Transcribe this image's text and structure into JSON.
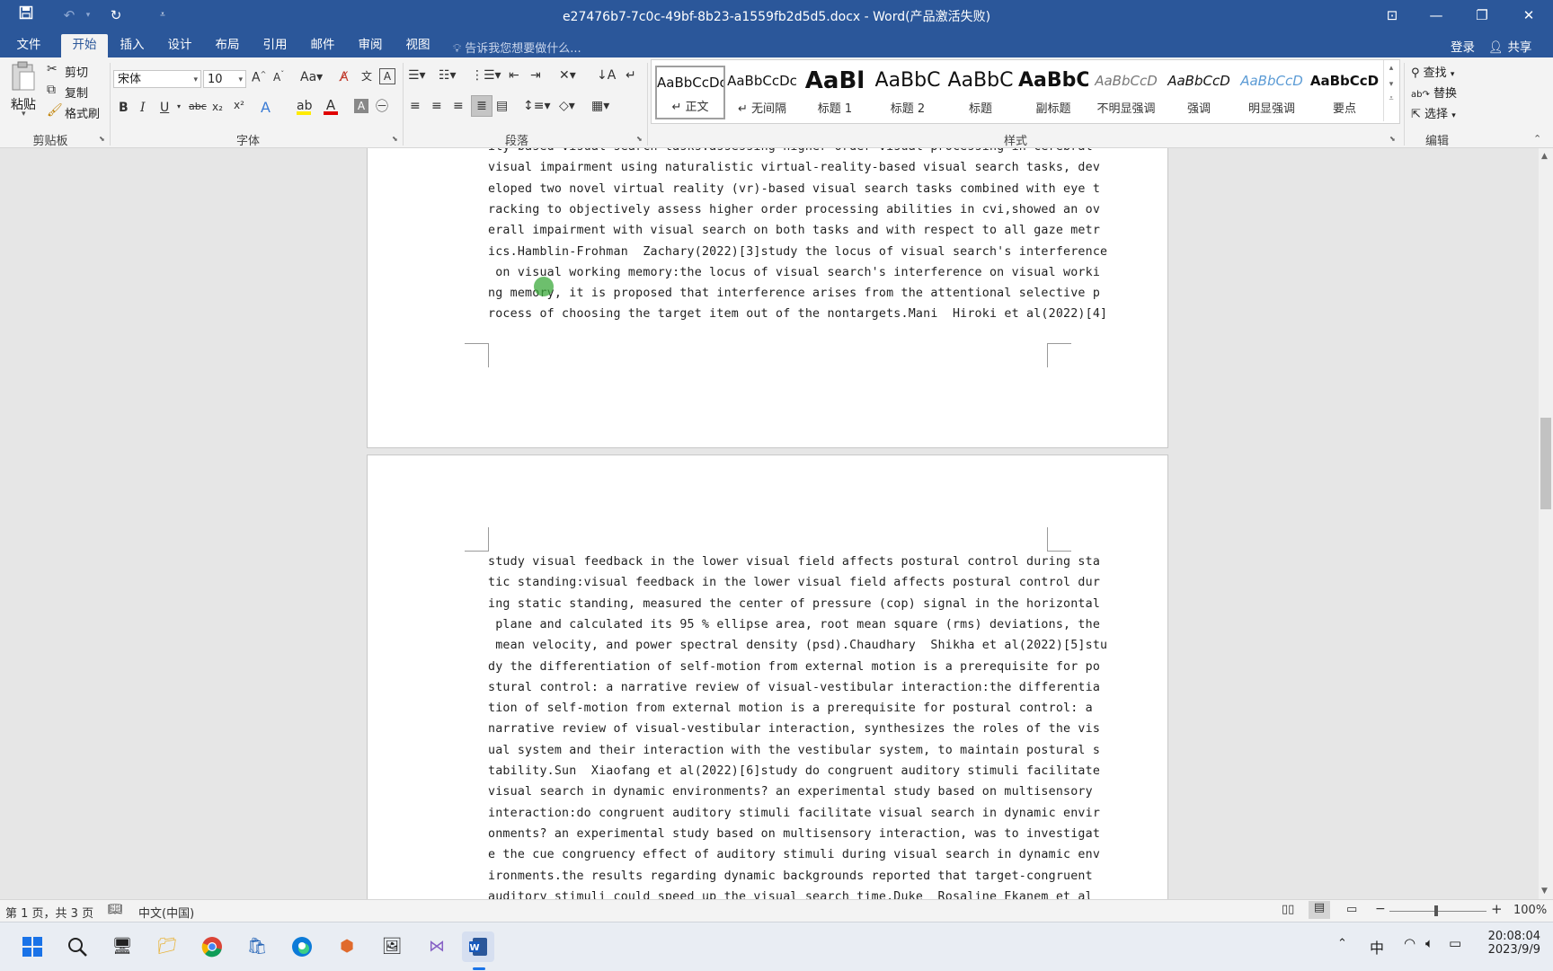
{
  "titlebar": {
    "title": "e27476b7-7c0c-49bf-8b23-a1559fb2d5d5.docx - Word(产品激活失败)",
    "qa_save": "save-icon",
    "qa_undo": "undo-icon",
    "qa_redo": "redo-icon"
  },
  "tabs": [
    "文件",
    "开始",
    "插入",
    "设计",
    "布局",
    "引用",
    "邮件",
    "审阅",
    "视图"
  ],
  "tell_me": "告诉我您想要做什么...",
  "signin": "登录",
  "share": "共享",
  "clipboard": {
    "paste": "粘贴",
    "cut": "剪切",
    "copy": "复制",
    "format_painter": "格式刷",
    "label": "剪贴板"
  },
  "font": {
    "name": "宋体",
    "size": "10",
    "label": "字体",
    "font_color": "#e00000",
    "highlight_color": "#ffeb00"
  },
  "paragraph": {
    "label": "段落"
  },
  "styles": {
    "label": "样式",
    "items": [
      {
        "preview": "AaBbCcDc",
        "name": "↵ 正文"
      },
      {
        "preview": "AaBbCcDc",
        "name": "↵ 无间隔"
      },
      {
        "preview": "AaBl",
        "name": "标题 1"
      },
      {
        "preview": "AaBbC",
        "name": "标题 2"
      },
      {
        "preview": "AaBbC",
        "name": "标题"
      },
      {
        "preview": "AaBbC",
        "name": "副标题"
      },
      {
        "preview": "AaBbCcD",
        "name": "不明显强调"
      },
      {
        "preview": "AaBbCcD",
        "name": "强调"
      },
      {
        "preview": "AaBbCcD",
        "name": "明显强调"
      },
      {
        "preview": "AaBbCcD",
        "name": "要点"
      }
    ]
  },
  "editing": {
    "find": "查找",
    "replace": "替换",
    "select": "选择",
    "label": "编辑"
  },
  "document": {
    "page1_lines": [
      "ity based visual search tasks:assessing higher order visual processing in cerebral",
      "visual impairment using naturalistic virtual-reality-based visual search tasks, dev",
      "eloped two novel virtual reality (vr)-based visual search tasks combined with eye t",
      "racking to objectively assess higher order processing abilities in cvi,showed an ov",
      "erall impairment with visual search on both tasks and with respect to all gaze metr",
      "ics.Hamblin-Frohman  Zachary(2022)[3]study the locus of visual search's interference",
      " on visual working memory:the locus of visual search's interference on visual worki",
      "ng memory, it is proposed that interference arises from the attentional selective p",
      "rocess of choosing the target item out of the nontargets.Mani  Hiroki et al(2022)[4]"
    ],
    "page2_lines": [
      "study visual feedback in the lower visual field affects postural control during sta",
      "tic standing:visual feedback in the lower visual field affects postural control dur",
      "ing static standing, measured the center of pressure (cop) signal in the horizontal",
      " plane and calculated its 95 % ellipse area, root mean square (rms) deviations, the",
      " mean velocity, and power spectral density (psd).Chaudhary  Shikha et al(2022)[5]stu",
      "dy the differentiation of self-motion from external motion is a prerequisite for po",
      "stural control: a narrative review of visual-vestibular interaction:the differentia",
      "tion of self-motion from external motion is a prerequisite for postural control: a ",
      "narrative review of visual-vestibular interaction, synthesizes the roles of the vis",
      "ual system and their interaction with the vestibular system, to maintain postural s",
      "tability.Sun  Xiaofang et al(2022)[6]study do congruent auditory stimuli facilitate ",
      "visual search in dynamic environments? an experimental study based on multisensory ",
      "interaction:do congruent auditory stimuli facilitate visual search in dynamic envir",
      "onments? an experimental study based on multisensory interaction, was to investigat",
      "e the cue congruency effect of auditory stimuli during visual search in dynamic env",
      "ironments.the results regarding dynamic backgrounds reported that target-congruent ",
      "auditory stimuli could speed up the visual search time.Duke  Rosaline Ekanem et al"
    ]
  },
  "statusbar": {
    "page_info": "第 1 页，共 3 页",
    "language": "中文(中国)",
    "zoom": "100%"
  },
  "taskbar": {
    "time": "20:08:04",
    "date": "2023/9/9",
    "ime": "中"
  }
}
